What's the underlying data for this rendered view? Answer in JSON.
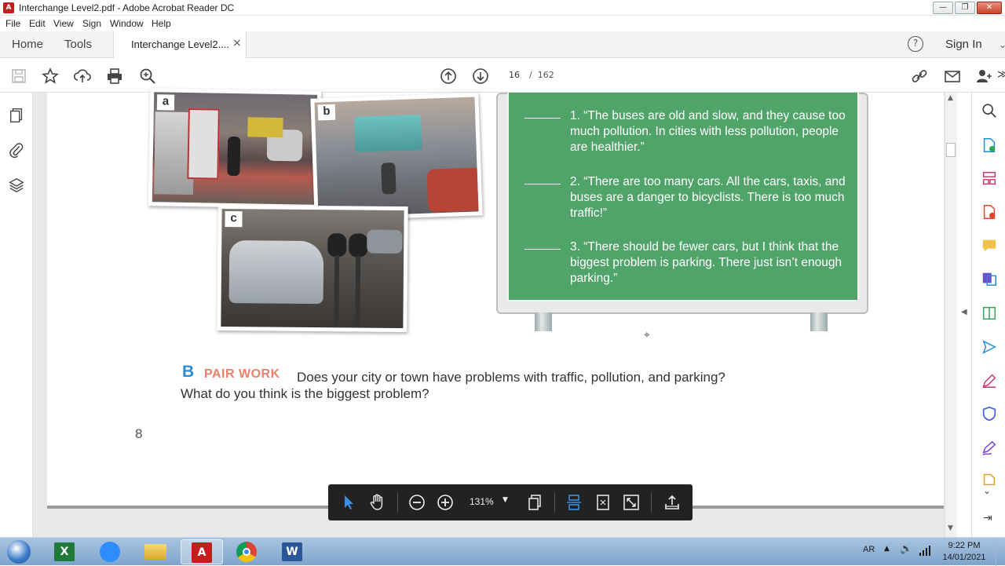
{
  "window": {
    "title": "Interchange Level2.pdf - Adobe Acrobat Reader DC",
    "controls": [
      "minimize",
      "restore",
      "close"
    ]
  },
  "menu": [
    "File",
    "Edit",
    "View",
    "Sign",
    "Window",
    "Help"
  ],
  "tabs": {
    "home": "Home",
    "tools": "Tools",
    "document": "Interchange Level2....",
    "close_glyph": "×"
  },
  "header_right": {
    "help_glyph": "?",
    "sign_in": "Sign In"
  },
  "toolbar": {
    "current_page": "16",
    "page_separator": "/",
    "total_pages": "162"
  },
  "document": {
    "photo_labels": [
      "a",
      "b",
      "c"
    ],
    "sign_items": [
      {
        "number": "1.",
        "text": "“The buses are old and slow, and they cause too much pollution. In cities with less pollution, people are healthier.”"
      },
      {
        "number": "2.",
        "text": "“There are too many cars. All the cars, taxis, and buses are a danger to bicyclists. There is too much traffic!”"
      },
      {
        "number": "3.",
        "text": "“There should be fewer cars, but I think that the biggest problem is parking. There just isn’t enough parking.”"
      }
    ],
    "exercise_letter": "B",
    "pair_work": "PAIR WORK",
    "question_line1": "Does your city or town have problems with traffic, pollution, and parking?",
    "question_line2": "What do you think is the biggest problem?",
    "page_number": "8"
  },
  "floating_toolbar": {
    "zoom": "131%"
  },
  "taskbar": {
    "apps": [
      "start",
      "excel",
      "zoom",
      "file-explorer",
      "acrobat-reader",
      "chrome",
      "word"
    ],
    "language": "AR",
    "time": "9:22 PM",
    "date": "14/01/2021"
  },
  "colors": {
    "sign_green": "#51a469",
    "pair_work": "#e9806a",
    "exercise_letter": "#2e8bd6",
    "acrobat_red": "#c21e1e",
    "floating_toolbar_bg": "#222222"
  }
}
